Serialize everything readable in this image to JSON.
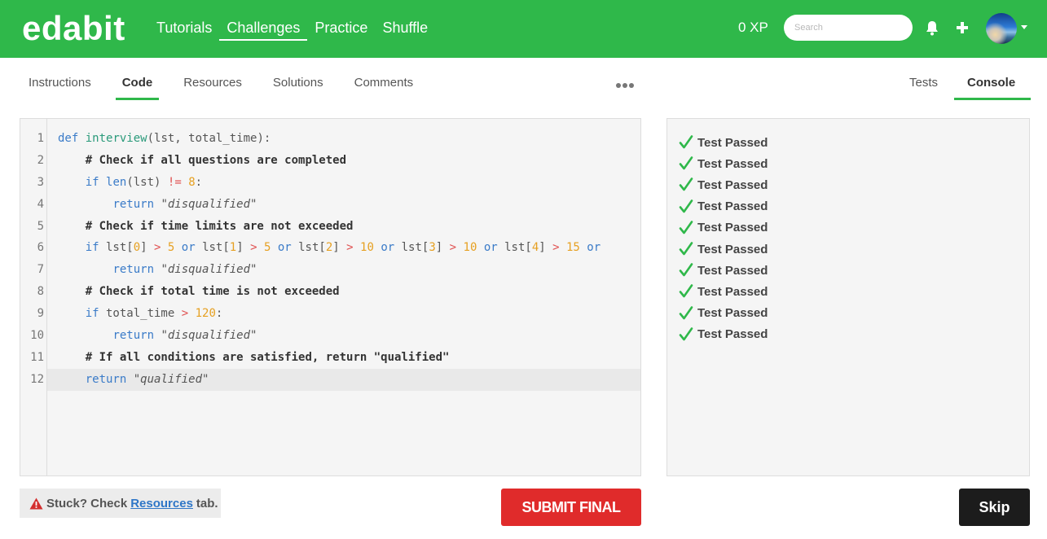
{
  "header": {
    "logo": "edabit",
    "nav": [
      {
        "label": "Tutorials",
        "active": false
      },
      {
        "label": "Challenges",
        "active": true
      },
      {
        "label": "Practice",
        "active": false
      },
      {
        "label": "Shuffle",
        "active": false
      }
    ],
    "xp": "0 XP",
    "search_placeholder": "Search",
    "icons": [
      "bell-icon",
      "plus-icon",
      "avatar",
      "chevron-down-icon"
    ]
  },
  "tabs_left": [
    {
      "label": "Instructions",
      "active": false
    },
    {
      "label": "Code",
      "active": true
    },
    {
      "label": "Resources",
      "active": false
    },
    {
      "label": "Solutions",
      "active": false
    },
    {
      "label": "Comments",
      "active": false
    }
  ],
  "tabs_right": [
    {
      "label": "Tests",
      "active": false
    },
    {
      "label": "Console",
      "active": true
    }
  ],
  "editor": {
    "lines": [
      {
        "n": "1",
        "text": "def interview(lst, total_time):"
      },
      {
        "n": "2",
        "text": "    # Check if all questions are completed"
      },
      {
        "n": "3",
        "text": "    if len(lst) != 8:"
      },
      {
        "n": "4",
        "text": "        return \"disqualified\""
      },
      {
        "n": "5",
        "text": "    # Check if time limits are not exceeded"
      },
      {
        "n": "6",
        "text": "    if lst[0] > 5 or lst[1] > 5 or lst[2] > 10 or lst[3] > 10 or lst[4] > 15 or"
      },
      {
        "n": "7",
        "text": "        return \"disqualified\""
      },
      {
        "n": "8",
        "text": "    # Check if total time is not exceeded"
      },
      {
        "n": "9",
        "text": "    if total_time > 120:"
      },
      {
        "n": "10",
        "text": "        return \"disqualified\""
      },
      {
        "n": "11",
        "text": "    # If all conditions are satisfied, return \"qualified\""
      },
      {
        "n": "12",
        "text": "    return \"qualified\""
      }
    ],
    "highlighted_line": 12
  },
  "console": {
    "results": [
      "Test Passed",
      "Test Passed",
      "Test Passed",
      "Test Passed",
      "Test Passed",
      "Test Passed",
      "Test Passed",
      "Test Passed",
      "Test Passed",
      "Test Passed"
    ]
  },
  "footer": {
    "stuck_prefix": "Stuck? Check",
    "stuck_link": "Resources",
    "stuck_suffix": "tab.",
    "submit_label": "SUBMIT FINAL",
    "skip_label": "Skip"
  },
  "colors": {
    "brand_green": "#2fb84a",
    "submit_red": "#e02b2b",
    "skip_black": "#1c1c1c",
    "link_blue": "#2e76c7"
  }
}
